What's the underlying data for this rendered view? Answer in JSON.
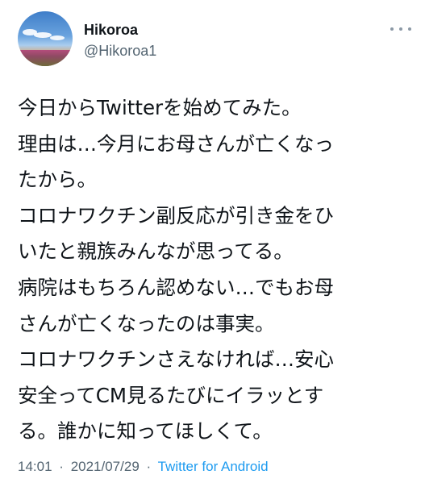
{
  "author": {
    "display_name": "Hikoroa",
    "handle": "@Hikoroa1"
  },
  "more_icon": "more-horizontal-icon",
  "tweet_lines": [
    "今日からTwitterを始めてみた。",
    "理由は…今月にお母さんが亡くなっ",
    "たから。",
    "コロナワクチン副反応が引き金をひ",
    "いたと親族みんなが思ってる。",
    "病院はもちろん認めない…でもお母",
    "さんが亡くなったのは事実。",
    "コロナワクチンさえなければ…安心",
    "安全ってCM見るたびにイラッとす",
    "る。誰かに知ってほしくて。"
  ],
  "meta": {
    "time": "14:01",
    "separator": "·",
    "date": "2021/07/29",
    "source": "Twitter for Android"
  },
  "colors": {
    "text": "#0f1419",
    "secondary": "#536471",
    "link": "#1d9bf0"
  }
}
